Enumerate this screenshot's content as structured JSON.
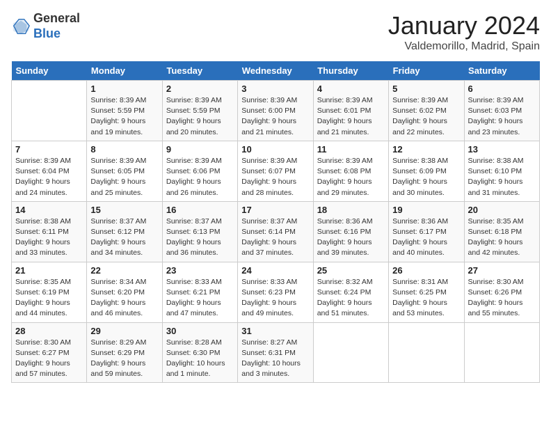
{
  "header": {
    "logo_line1": "General",
    "logo_line2": "Blue",
    "month": "January 2024",
    "location": "Valdemorillo, Madrid, Spain"
  },
  "weekdays": [
    "Sunday",
    "Monday",
    "Tuesday",
    "Wednesday",
    "Thursday",
    "Friday",
    "Saturday"
  ],
  "weeks": [
    [
      {
        "day": "",
        "info": ""
      },
      {
        "day": "1",
        "info": "Sunrise: 8:39 AM\nSunset: 5:59 PM\nDaylight: 9 hours\nand 19 minutes."
      },
      {
        "day": "2",
        "info": "Sunrise: 8:39 AM\nSunset: 5:59 PM\nDaylight: 9 hours\nand 20 minutes."
      },
      {
        "day": "3",
        "info": "Sunrise: 8:39 AM\nSunset: 6:00 PM\nDaylight: 9 hours\nand 21 minutes."
      },
      {
        "day": "4",
        "info": "Sunrise: 8:39 AM\nSunset: 6:01 PM\nDaylight: 9 hours\nand 21 minutes."
      },
      {
        "day": "5",
        "info": "Sunrise: 8:39 AM\nSunset: 6:02 PM\nDaylight: 9 hours\nand 22 minutes."
      },
      {
        "day": "6",
        "info": "Sunrise: 8:39 AM\nSunset: 6:03 PM\nDaylight: 9 hours\nand 23 minutes."
      }
    ],
    [
      {
        "day": "7",
        "info": "Sunrise: 8:39 AM\nSunset: 6:04 PM\nDaylight: 9 hours\nand 24 minutes."
      },
      {
        "day": "8",
        "info": "Sunrise: 8:39 AM\nSunset: 6:05 PM\nDaylight: 9 hours\nand 25 minutes."
      },
      {
        "day": "9",
        "info": "Sunrise: 8:39 AM\nSunset: 6:06 PM\nDaylight: 9 hours\nand 26 minutes."
      },
      {
        "day": "10",
        "info": "Sunrise: 8:39 AM\nSunset: 6:07 PM\nDaylight: 9 hours\nand 28 minutes."
      },
      {
        "day": "11",
        "info": "Sunrise: 8:39 AM\nSunset: 6:08 PM\nDaylight: 9 hours\nand 29 minutes."
      },
      {
        "day": "12",
        "info": "Sunrise: 8:38 AM\nSunset: 6:09 PM\nDaylight: 9 hours\nand 30 minutes."
      },
      {
        "day": "13",
        "info": "Sunrise: 8:38 AM\nSunset: 6:10 PM\nDaylight: 9 hours\nand 31 minutes."
      }
    ],
    [
      {
        "day": "14",
        "info": "Sunrise: 8:38 AM\nSunset: 6:11 PM\nDaylight: 9 hours\nand 33 minutes."
      },
      {
        "day": "15",
        "info": "Sunrise: 8:37 AM\nSunset: 6:12 PM\nDaylight: 9 hours\nand 34 minutes."
      },
      {
        "day": "16",
        "info": "Sunrise: 8:37 AM\nSunset: 6:13 PM\nDaylight: 9 hours\nand 36 minutes."
      },
      {
        "day": "17",
        "info": "Sunrise: 8:37 AM\nSunset: 6:14 PM\nDaylight: 9 hours\nand 37 minutes."
      },
      {
        "day": "18",
        "info": "Sunrise: 8:36 AM\nSunset: 6:16 PM\nDaylight: 9 hours\nand 39 minutes."
      },
      {
        "day": "19",
        "info": "Sunrise: 8:36 AM\nSunset: 6:17 PM\nDaylight: 9 hours\nand 40 minutes."
      },
      {
        "day": "20",
        "info": "Sunrise: 8:35 AM\nSunset: 6:18 PM\nDaylight: 9 hours\nand 42 minutes."
      }
    ],
    [
      {
        "day": "21",
        "info": "Sunrise: 8:35 AM\nSunset: 6:19 PM\nDaylight: 9 hours\nand 44 minutes."
      },
      {
        "day": "22",
        "info": "Sunrise: 8:34 AM\nSunset: 6:20 PM\nDaylight: 9 hours\nand 46 minutes."
      },
      {
        "day": "23",
        "info": "Sunrise: 8:33 AM\nSunset: 6:21 PM\nDaylight: 9 hours\nand 47 minutes."
      },
      {
        "day": "24",
        "info": "Sunrise: 8:33 AM\nSunset: 6:23 PM\nDaylight: 9 hours\nand 49 minutes."
      },
      {
        "day": "25",
        "info": "Sunrise: 8:32 AM\nSunset: 6:24 PM\nDaylight: 9 hours\nand 51 minutes."
      },
      {
        "day": "26",
        "info": "Sunrise: 8:31 AM\nSunset: 6:25 PM\nDaylight: 9 hours\nand 53 minutes."
      },
      {
        "day": "27",
        "info": "Sunrise: 8:30 AM\nSunset: 6:26 PM\nDaylight: 9 hours\nand 55 minutes."
      }
    ],
    [
      {
        "day": "28",
        "info": "Sunrise: 8:30 AM\nSunset: 6:27 PM\nDaylight: 9 hours\nand 57 minutes."
      },
      {
        "day": "29",
        "info": "Sunrise: 8:29 AM\nSunset: 6:29 PM\nDaylight: 9 hours\nand 59 minutes."
      },
      {
        "day": "30",
        "info": "Sunrise: 8:28 AM\nSunset: 6:30 PM\nDaylight: 10 hours\nand 1 minute."
      },
      {
        "day": "31",
        "info": "Sunrise: 8:27 AM\nSunset: 6:31 PM\nDaylight: 10 hours\nand 3 minutes."
      },
      {
        "day": "",
        "info": ""
      },
      {
        "day": "",
        "info": ""
      },
      {
        "day": "",
        "info": ""
      }
    ]
  ]
}
